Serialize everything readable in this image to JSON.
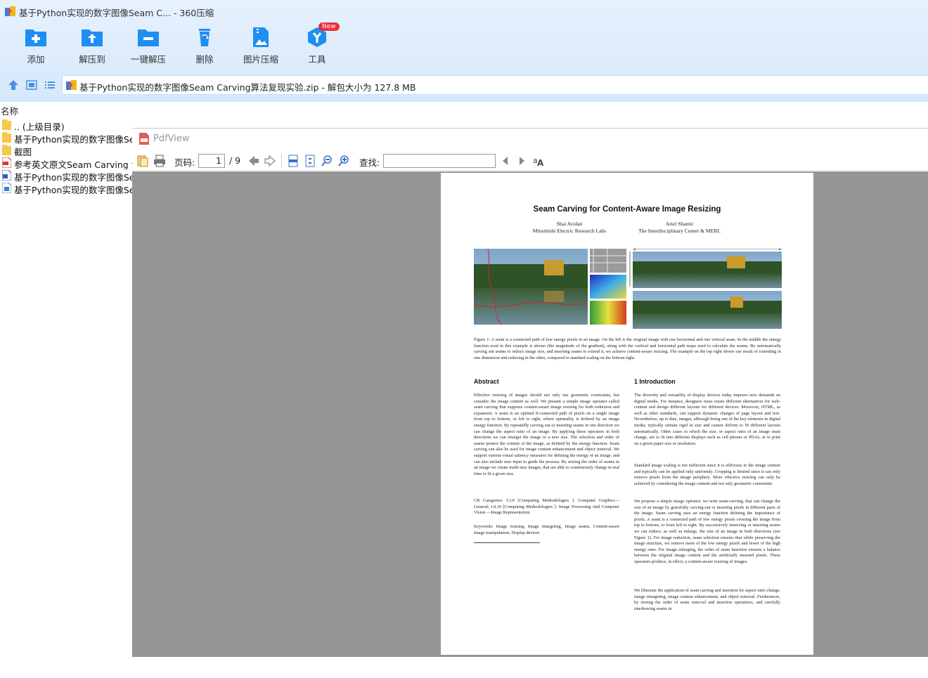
{
  "window": {
    "title": "基于Python实现的数字图像Seam C... - 360压缩"
  },
  "toolbar": {
    "add": "添加",
    "extract_to": "解压到",
    "one_click_extract": "一键解压",
    "delete": "删除",
    "image_compress": "图片压缩",
    "tools": "工具",
    "new_badge": "New"
  },
  "address": {
    "path": "基于Python实现的数字图像Seam Carving算法复现实验.zip - 解包大小为 127.8 MB"
  },
  "filelist": {
    "column_name": "名称",
    "rows": [
      {
        "name": ".. (上级目录)",
        "icon": "folder-icon"
      },
      {
        "name": "基于Python实现的数字图像Sea",
        "icon": "folder-icon"
      },
      {
        "name": "截图",
        "icon": "folder-icon"
      },
      {
        "name": "参考英文原文Seam Carving fo",
        "icon": "pdf-file-icon"
      },
      {
        "name": "基于Python实现的数字图像Sea",
        "icon": "word-file-icon"
      },
      {
        "name": "基于Python实现的数字图像Sea",
        "icon": "doc-file-icon"
      }
    ]
  },
  "pdfview": {
    "title": "PdfView",
    "page_label": "页码:",
    "current_page": "1",
    "total_pages": "/ 9",
    "find_label": "查找:"
  },
  "paper": {
    "title": "Seam Carving for Content-Aware Image Resizing",
    "author1_name": "Shai Avidan",
    "author1_affil": "Mitsubishi Electric Research Labs",
    "author2_name": "Ariel Shamir",
    "author2_affil": "The Interdisciplinary Center & MERL",
    "figure_caption": "Figure 1: A seam is a connected path of low energy pixels in an image. On the left is the original image with one horizontal and one vertical seam. In the middle the energy function used in this example is shown (the magnitude of the gradient), along with the vertical and horizontal path maps used to calculate the seams. By automatically carving out seams to reduce image size, and inserting seams to extend it, we achieve content-aware resizing. The example on the top right shows our result of extending in one dimension and reducing in the other, compared to standard scaling on the bottom right.",
    "abstract_heading": "Abstract",
    "abstract_text": "Effective resizing of images should not only use geometric constraints, but consider the image content as well. We present a simple image operator called seam carving that supports content-aware image resizing for both reduction and expansion. A seam is an optimal 8-connected path of pixels on a single image from top to bottom, or left to right, where optimality is defined by an image energy function. By repeatedly carving out or inserting seams in one direction we can change the aspect ratio of an image. By applying these operators in both directions we can retarget the image to a new size. The selection and order of seams protect the content of the image, as defined by the energy function. Seam carving can also be used for image content enhancement and object removal. We support various visual saliency measures for defining the energy of an image, and can also include user input to guide the process. By storing the order of seams in an image we create multi-size images, that are able to continuously change in real time to fit a given size.",
    "cr_text": "CR Categories: I.3.0 [Computing Methodologies ]: Computer Graphics—General; I.4.10 [Computing Methodologies ]: Image Processing And Computer Vision —Image Representation",
    "keywords_text": "Keywords: Image resizing, Image retargeting, Image seams, Content-aware image manipulation, Display devices",
    "intro_heading": "1    Introduction",
    "intro_p1": "The diversity and versatility of display devices today imposes new demands on digital media. For instance, designers must create different alternatives for web-content and design different layouts for different devices. Moreover, HTML, as well as other standards, can support dynamic changes of page layout and text. Nevertheless, up to date, images, although being one of the key elements in digital media, typically remain rigid in size and cannot deform to fit different layouts automatically. Other cases in which the size, or aspect ratio of an image must change, are to fit into different displays such as cell phones or PDAs, or to print on a given paper size or resolution.",
    "intro_p2": "Standard image scaling is not sufficient since it is oblivious to the image content and typically can be applied only uniformly. Cropping is limited since it can only remove pixels from the image periphery. More effective resizing can only be achieved by considering the image content and not only geometric constraints.",
    "intro_p3": "We propose a simple image operator, we term seam-carving, that can change the size of an image by gracefully carving-out or inserting pixels in different parts of the image. Seam carving uses an energy function defining the importance of pixels. A seam is a connected path of low energy pixels crossing the image from top to bottom, or from left to right. By successively removing or inserting seams we can reduce, as well as enlarge, the size of an image in both directions (see Figure 1). For image reduction, seam selection ensures that while preserving the image structure, we remove more of the low energy pixels and fewer of the high energy ones. For image enlarging, the order of seam insertion ensures a balance between the original image content and the artificially inserted pixels. These operators produce, in effect, a content-aware resizing of images.",
    "intro_p4": "We illustrate the application of seam carving and insertion for aspect ratio change, image retargeting, image content enhancement, and object removal. Furthermore, by storing the order of seam removal and insertion operations, and carefully interleaving seams in"
  },
  "colors": {
    "toolbar_icon_blue": "#1f8ef1",
    "new_badge_red": "#e8313b",
    "pdf_canvas_gray": "#959595"
  }
}
